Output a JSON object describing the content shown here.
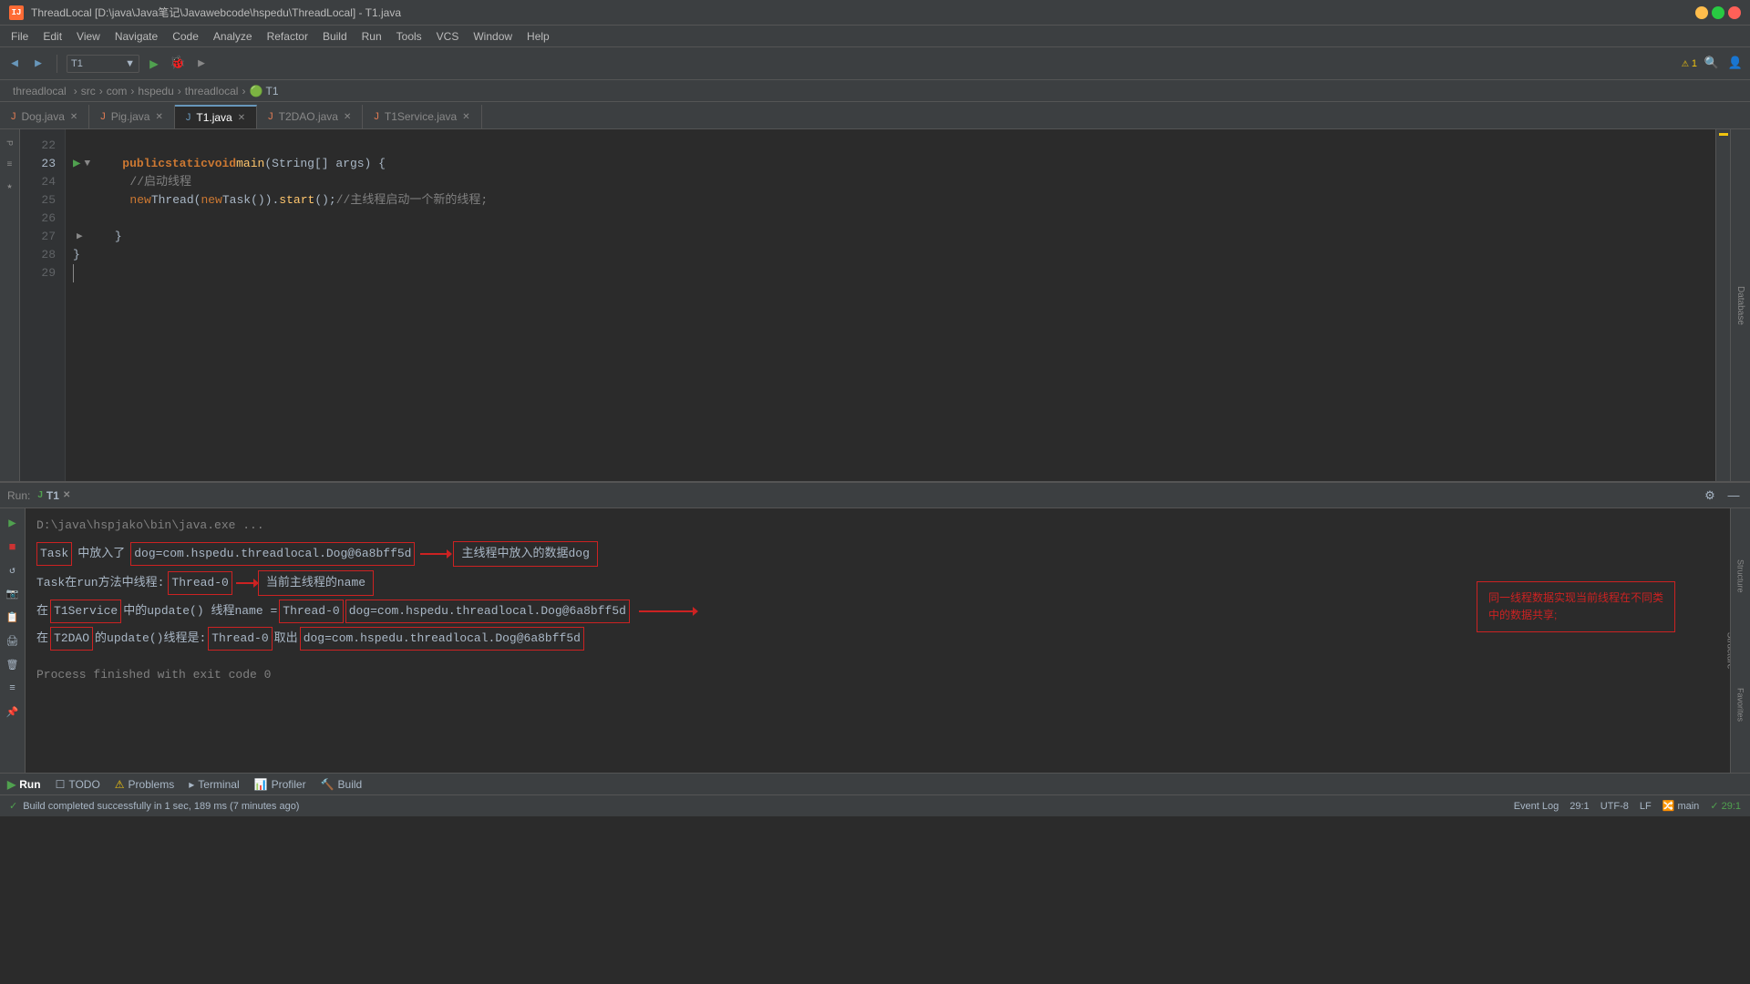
{
  "titlebar": {
    "title": "ThreadLocal [D:\\java\\Java笔记\\Javawebcode\\hspedu\\ThreadLocal] - T1.java",
    "app_icon": "IJ"
  },
  "menubar": {
    "items": [
      "File",
      "Edit",
      "View",
      "Navigate",
      "Code",
      "Analyze",
      "Refactor",
      "Build",
      "Run",
      "Tools",
      "VCS",
      "Window",
      "Help"
    ]
  },
  "breadcrumb": {
    "items": [
      "threadlocal",
      "src",
      "com",
      "hspedu",
      "threadlocal",
      "T1"
    ]
  },
  "tabs": [
    {
      "label": "Dog.java",
      "active": false,
      "icon": "java"
    },
    {
      "label": "Pig.java",
      "active": false,
      "icon": "java"
    },
    {
      "label": "T1.java",
      "active": true,
      "icon": "java"
    },
    {
      "label": "T2DAO.java",
      "active": false,
      "icon": "java"
    },
    {
      "label": "T1Service.java",
      "active": false,
      "icon": "java"
    }
  ],
  "editor": {
    "lines": [
      {
        "num": 22,
        "content": ""
      },
      {
        "num": 23,
        "content": "    public static void main(String[] args) {",
        "has_run": true,
        "has_fold": true
      },
      {
        "num": 24,
        "content": "        //启动线程"
      },
      {
        "num": 25,
        "content": "        new Thread(new Task()).start();//主线程启动一个新的线程;"
      },
      {
        "num": 26,
        "content": ""
      },
      {
        "num": 27,
        "content": "    }",
        "has_fold": true
      },
      {
        "num": 28,
        "content": "}"
      },
      {
        "num": 29,
        "content": ""
      }
    ]
  },
  "run_panel": {
    "tab_label": "T1",
    "header_path": "D:\\java\\hspjako\\bin\\java.exe ...",
    "output_lines": [
      {
        "text": "Task中放入了  dog=com.hspedu.threadlocal.Dog@6a8bff5d",
        "annotation": "主线程中放入的数据dog",
        "has_task_box": true,
        "has_dog_box": true
      },
      {
        "text": "Task在run方法中线程:Thread-0",
        "annotation": "当前主线程的name",
        "has_annotation": true
      },
      {
        "text": "在T1Service中的update() 线程name = Thread-0dog=com.hspedu.threadlocal.Dog@6a8bff5d",
        "has_t1service_box": true,
        "has_thread_box": true
      },
      {
        "text": "在T2DAO的update()线程是:Thread-0取出dog=com.hspedu.threadlocal.Dog@6a8bff5d",
        "has_t2dao_box": true,
        "has_threadout_box": true
      }
    ],
    "annotation_right": "同一线程数据实现当前线程在不同类\n中的数据共享;",
    "process_done": "Process finished with exit code 0"
  },
  "bottom_toolbar": {
    "items": [
      {
        "label": "Run",
        "icon": "run",
        "active": true
      },
      {
        "label": "TODO",
        "icon": "todo"
      },
      {
        "label": "Problems",
        "icon": "problems"
      },
      {
        "label": "Terminal",
        "icon": "terminal"
      },
      {
        "label": "Profiler",
        "icon": "profiler"
      },
      {
        "label": "Build",
        "icon": "build"
      }
    ]
  },
  "status_bar": {
    "left": "Build completed successfully in 1 sec, 189 ms (7 minutes ago)",
    "right_position": "29:1",
    "event_log": "Event Log"
  },
  "toolbar_right": {
    "class_selector": "T1",
    "warning_count": "1"
  }
}
